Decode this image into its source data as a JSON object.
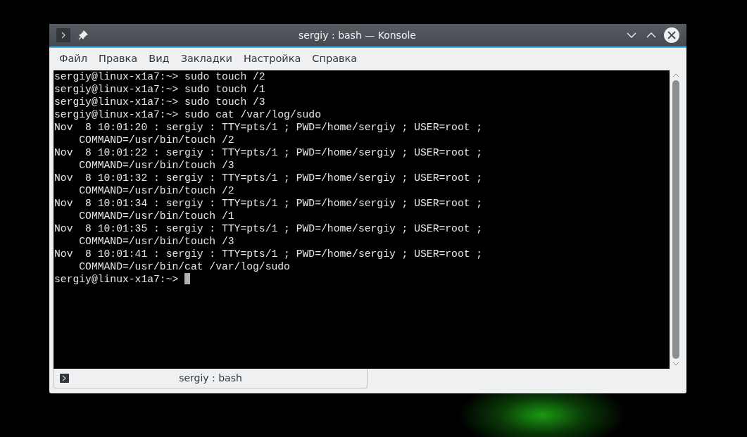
{
  "window": {
    "title": "sergiy : bash — Konsole"
  },
  "menu": [
    "Файл",
    "Правка",
    "Вид",
    "Закладки",
    "Настройка",
    "Справка"
  ],
  "terminal": {
    "lines": [
      {
        "text": "sergiy@linux-x1a7:~> sudo touch /2"
      },
      {
        "text": "sergiy@linux-x1a7:~> sudo touch /1"
      },
      {
        "text": "sergiy@linux-x1a7:~> sudo touch /3"
      },
      {
        "text": "sergiy@linux-x1a7:~> sudo cat /var/log/sudo"
      },
      {
        "text": "Nov  8 10:01:20 : sergiy : TTY=pts/1 ; PWD=/home/sergiy ; USER=root ;"
      },
      {
        "text": "    COMMAND=/usr/bin/touch /2"
      },
      {
        "text": "Nov  8 10:01:22 : sergiy : TTY=pts/1 ; PWD=/home/sergiy ; USER=root ;"
      },
      {
        "text": "    COMMAND=/usr/bin/touch /3"
      },
      {
        "text": "Nov  8 10:01:32 : sergiy : TTY=pts/1 ; PWD=/home/sergiy ; USER=root ;"
      },
      {
        "text": "    COMMAND=/usr/bin/touch /2"
      },
      {
        "text": "Nov  8 10:01:34 : sergiy : TTY=pts/1 ; PWD=/home/sergiy ; USER=root ;"
      },
      {
        "text": "    COMMAND=/usr/bin/touch /1"
      },
      {
        "text": "Nov  8 10:01:35 : sergiy : TTY=pts/1 ; PWD=/home/sergiy ; USER=root ;"
      },
      {
        "text": "    COMMAND=/usr/bin/touch /3"
      },
      {
        "text": "Nov  8 10:01:41 : sergiy : TTY=pts/1 ; PWD=/home/sergiy ; USER=root ;"
      },
      {
        "text": "    COMMAND=/usr/bin/cat /var/log/sudo"
      },
      {
        "text": "sergiy@linux-x1a7:~> ",
        "cursor": true
      }
    ]
  },
  "tabs": [
    {
      "label": "sergiy : bash",
      "selected": true
    }
  ]
}
